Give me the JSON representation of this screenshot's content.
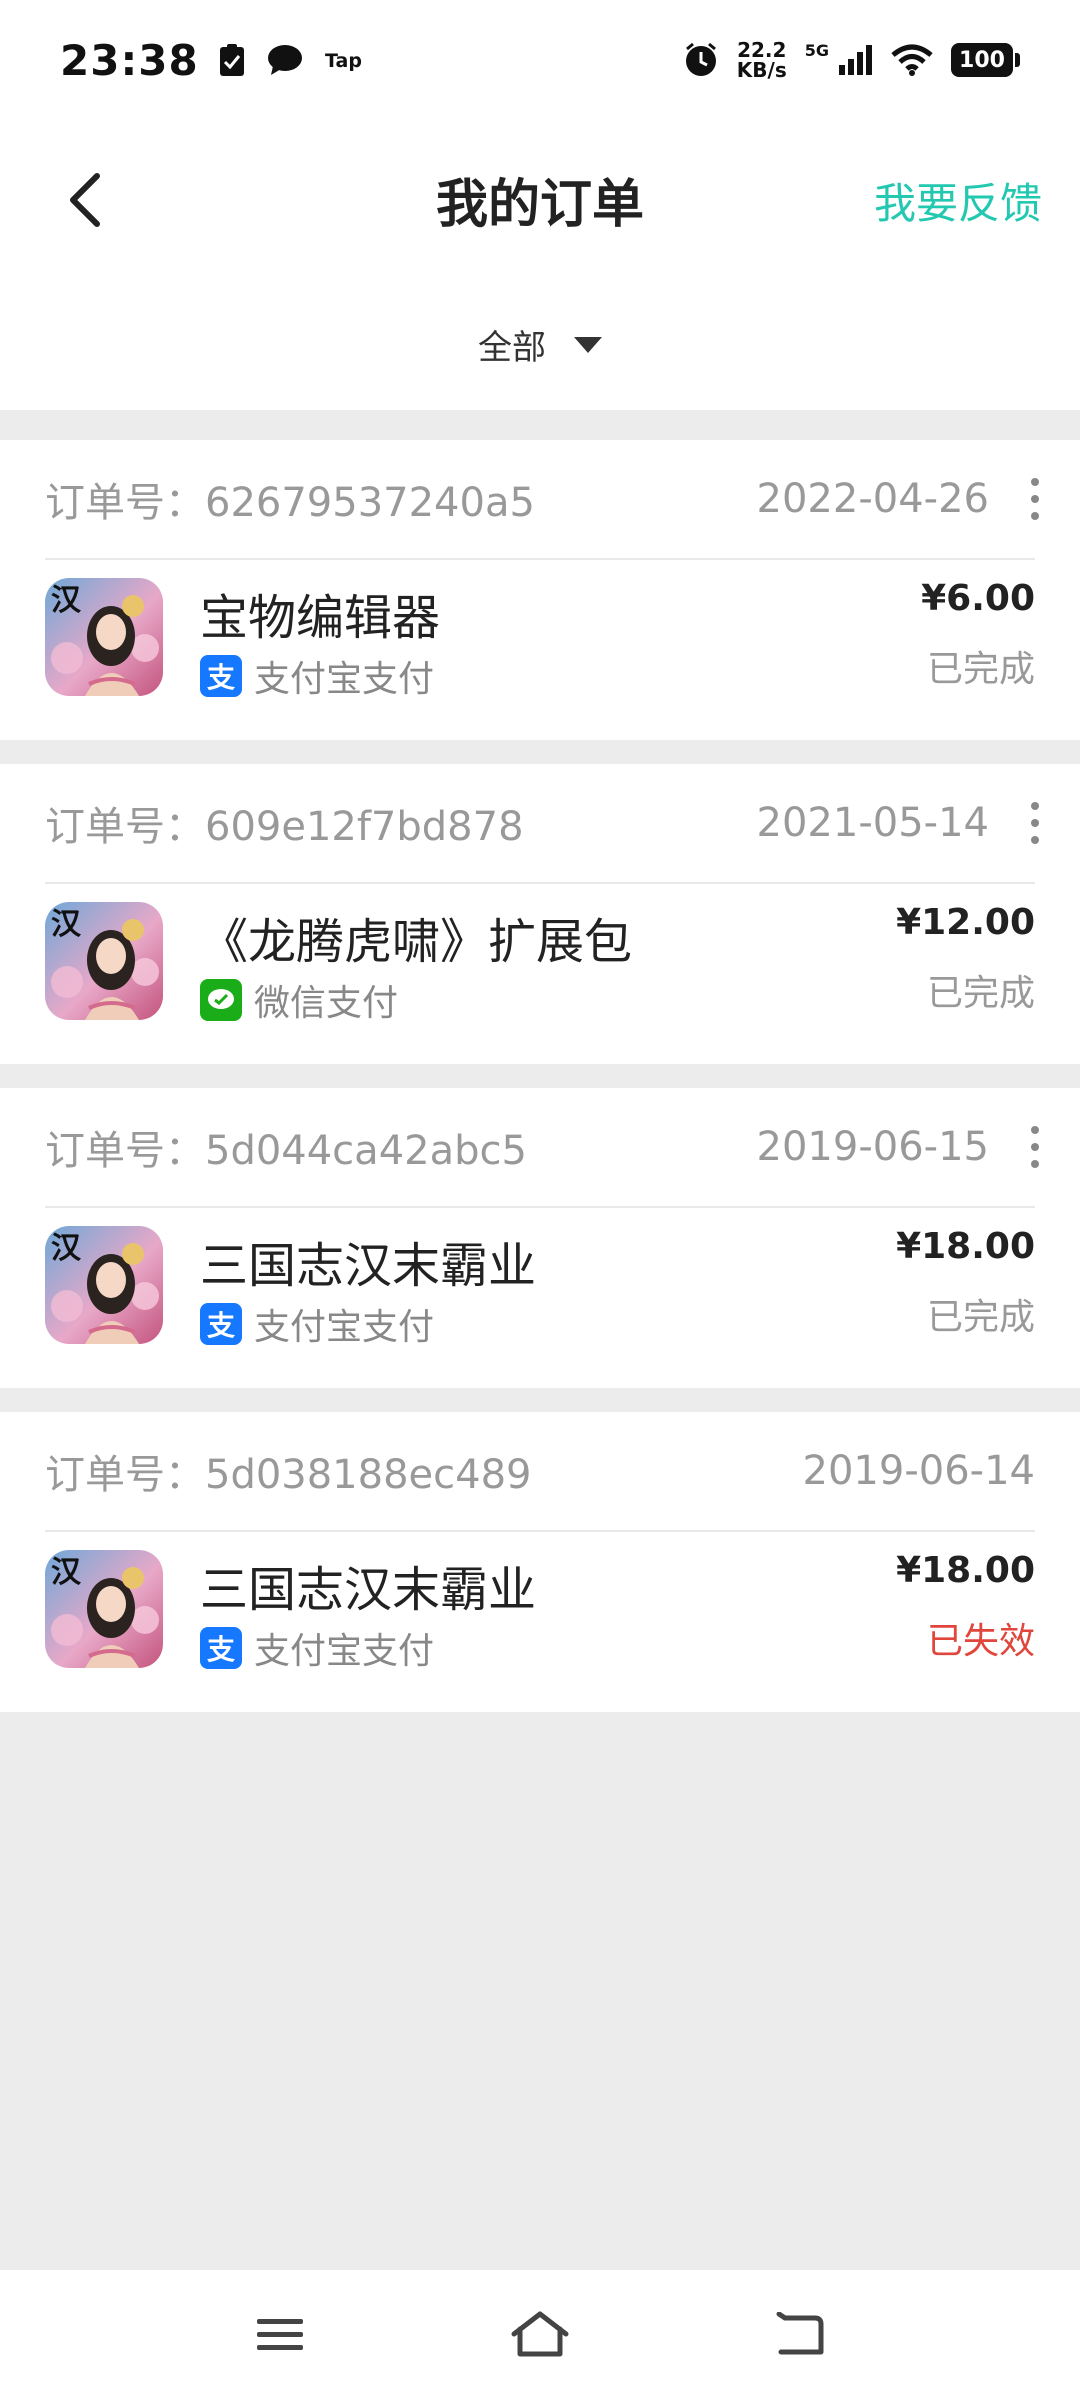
{
  "status_bar": {
    "time": "23:38",
    "net_speed_value": "22.2",
    "net_speed_unit": "KB/s",
    "network_type": "5G",
    "battery": "100"
  },
  "header": {
    "title": "我的订单",
    "feedback_label": "我要反馈",
    "filter_label": "全部"
  },
  "orders": [
    {
      "order_no": "订单号：62679537240a5",
      "date": "2022-04-26",
      "product": "宝物编辑器",
      "payment": "支付宝支付",
      "payment_icon": "alipay-icon",
      "price": "¥6.00",
      "status": "已完成",
      "has_more": true
    },
    {
      "order_no": "订单号：609e12f7bd878",
      "date": "2021-05-14",
      "product": "《龙腾虎啸》扩展包",
      "payment": "微信支付",
      "payment_icon": "wechat-pay-icon",
      "price": "¥12.00",
      "status": "已完成",
      "has_more": true
    },
    {
      "order_no": "订单号：5d044ca42abc5",
      "date": "2019-06-15",
      "product": "三国志汉末霸业",
      "payment": "支付宝支付",
      "payment_icon": "alipay-icon",
      "price": "¥18.00",
      "status": "已完成",
      "has_more": true
    },
    {
      "order_no": "订单号：5d038188ec489",
      "date": "2019-06-14",
      "product": "三国志汉末霸业",
      "payment": "支付宝支付",
      "payment_icon": "alipay-icon",
      "price": "¥18.00",
      "status": "已失效",
      "has_more": false
    }
  ],
  "app_icon_glyph": "汉",
  "alipay_glyph": "支",
  "colors": {
    "accent": "#22c8b0",
    "alipay": "#1677ff",
    "wechat": "#1aad19",
    "invalid_status": "#e0463c"
  }
}
